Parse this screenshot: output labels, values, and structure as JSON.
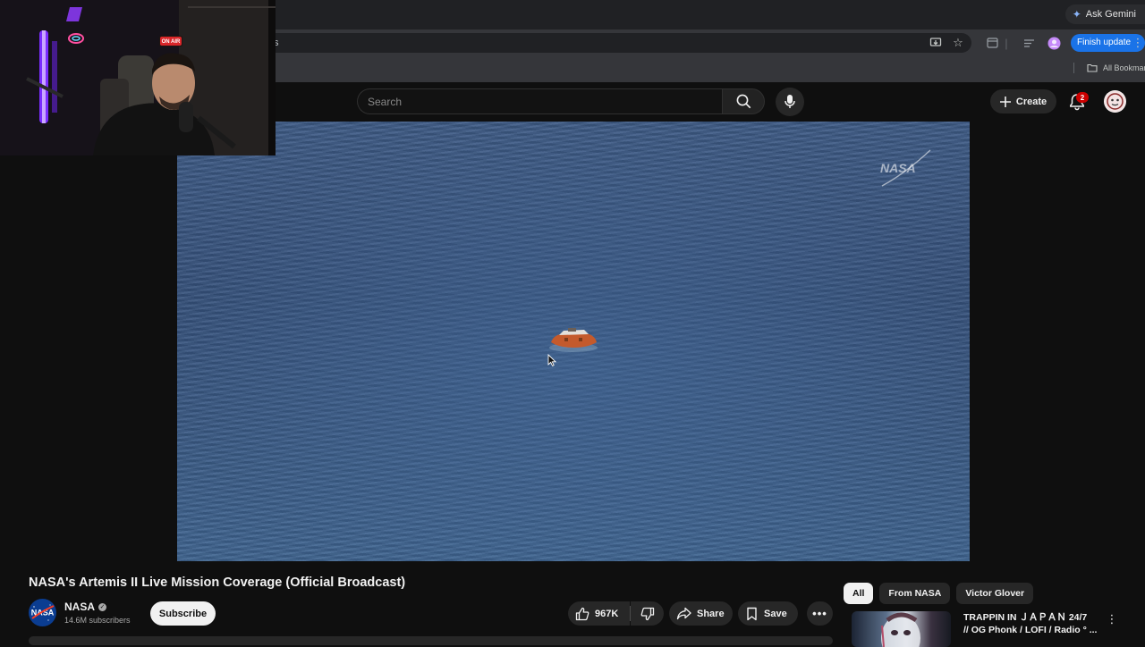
{
  "browser": {
    "ask_gemini_label": "Ask Gemini",
    "url_fragment": "s",
    "finish_update_label": "Finish update",
    "bookmarks_label": "All Bookmarks"
  },
  "youtube": {
    "search": {
      "placeholder": "Search"
    },
    "create_label": "Create",
    "notification_count": "2"
  },
  "webcam": {
    "on_air_label": "ON AIR"
  },
  "player": {
    "watermark": "NASA"
  },
  "video": {
    "title": "NASA's Artemis II Live Mission Coverage (Official Broadcast)",
    "channel": {
      "name": "NASA",
      "subscribers": "14.6M subscribers",
      "subscribe_label": "Subscribe",
      "avatar_text": "NASA"
    },
    "actions": {
      "likes": "967K",
      "share_label": "Share",
      "save_label": "Save"
    }
  },
  "sidebar": {
    "chips": [
      "All",
      "From NASA",
      "Victor Glover"
    ],
    "active_chip": "All",
    "recommendation": {
      "title_line1": "TRAPPIN IN ＪＡＰＡＮ 24/7",
      "title_line2": "// OG Phonk / LOFI / Radio ° ..."
    }
  },
  "colors": {
    "accent_blue": "#1a73e8",
    "badge_red": "#cc0000",
    "background": "#0f0f0f"
  }
}
